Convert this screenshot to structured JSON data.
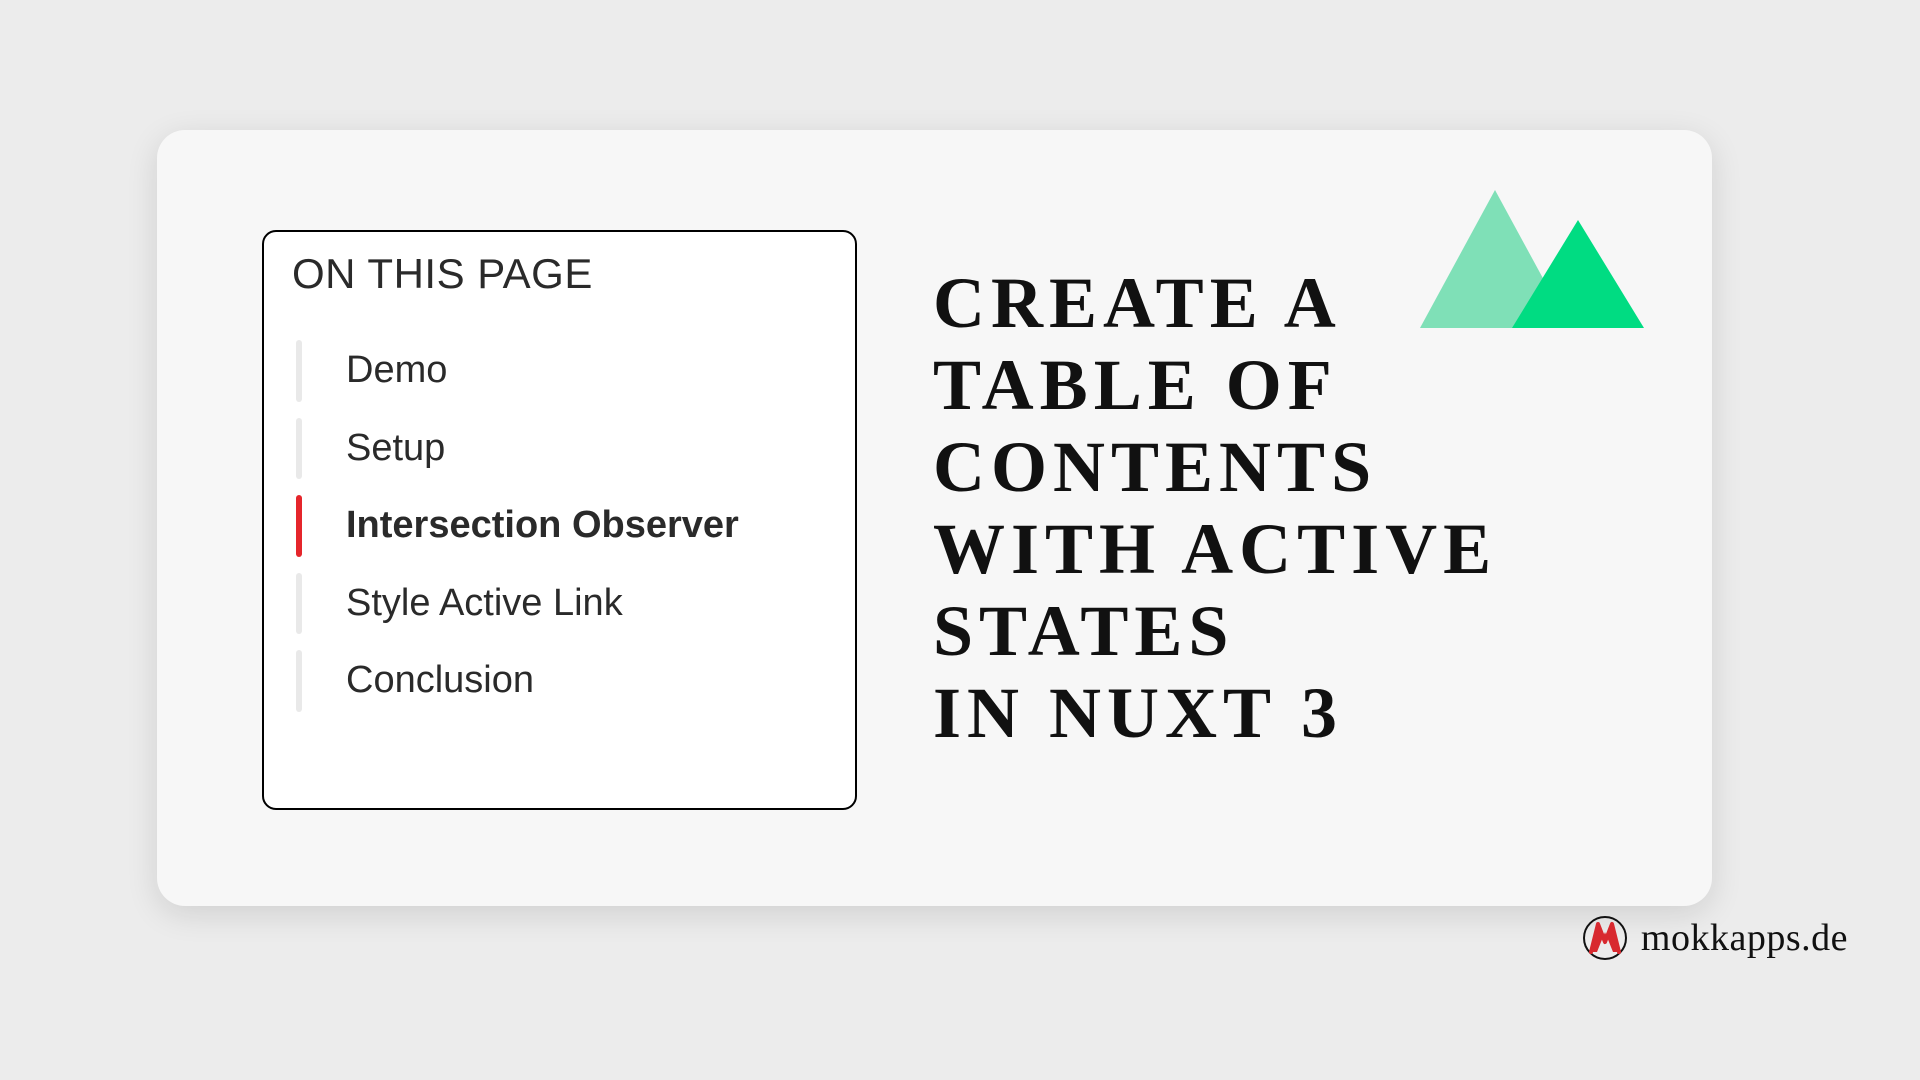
{
  "toc": {
    "title": "ON THIS PAGE",
    "items": [
      {
        "label": "Demo",
        "active": false
      },
      {
        "label": "Setup",
        "active": false
      },
      {
        "label": "Intersection Observer",
        "active": true
      },
      {
        "label": "Style Active Link",
        "active": false
      },
      {
        "label": "Conclusion",
        "active": false
      }
    ]
  },
  "headline": "CREATE A TABLE OF CONTENTS WITH ACTIVE STATES IN NUXT 3",
  "brand": {
    "text": "mokkapps.de"
  },
  "colors": {
    "accent_active": "#e5252b",
    "nuxt_light": "#7fe0b7",
    "nuxt_dark": "#00dc82",
    "brand_red": "#d8292f"
  }
}
